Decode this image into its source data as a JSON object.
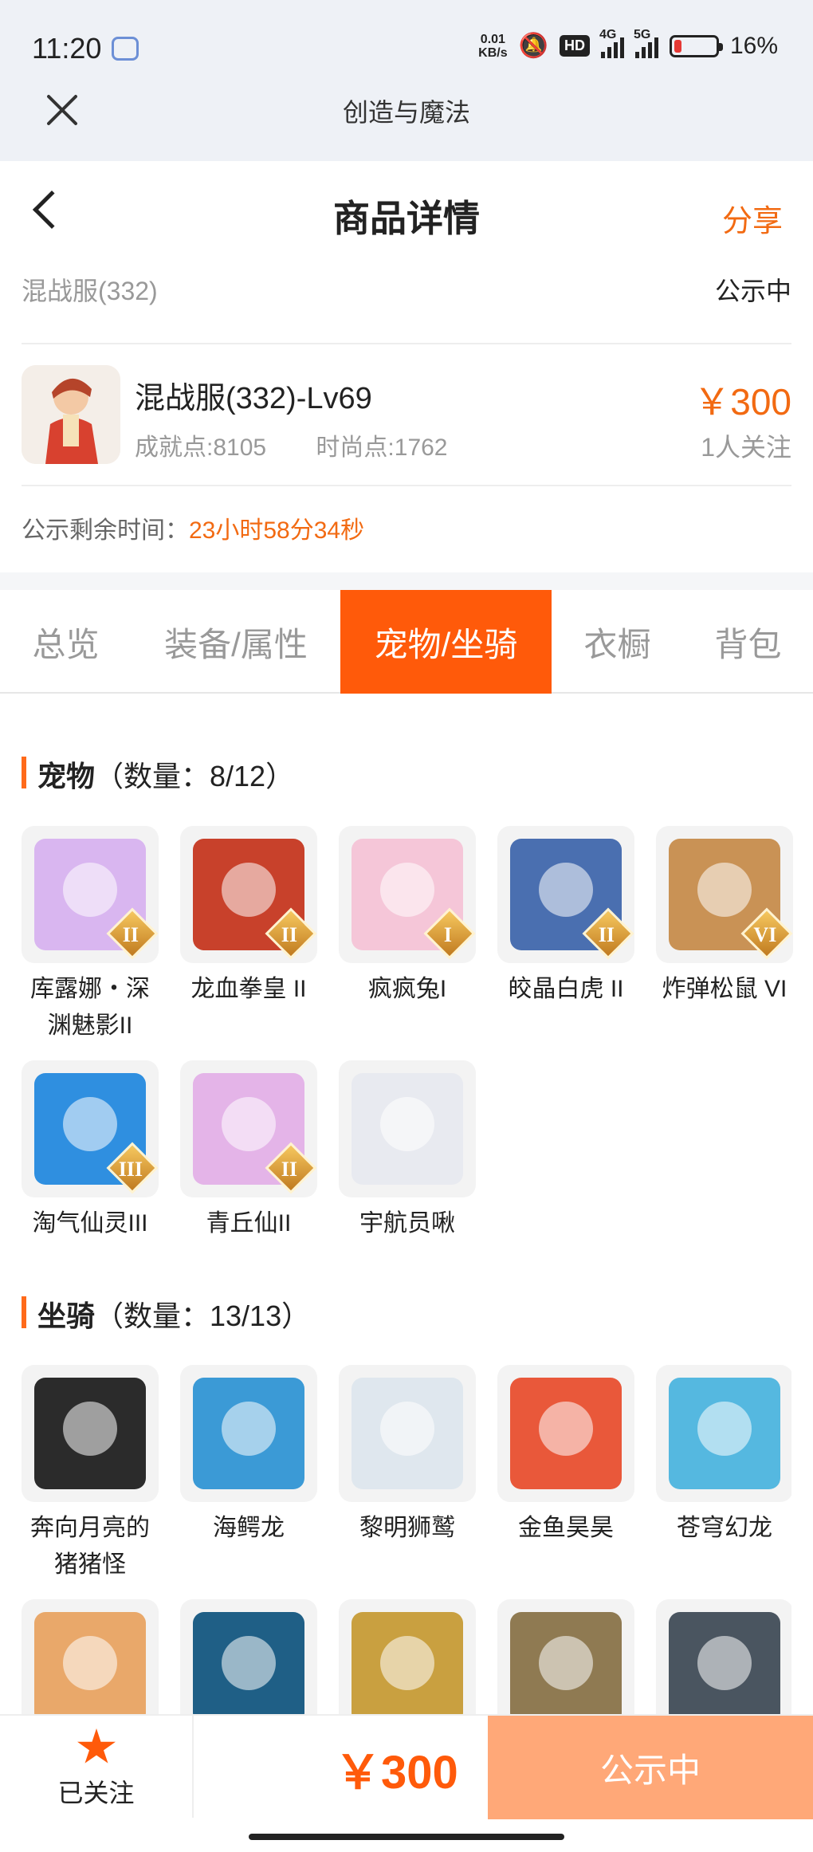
{
  "status_bar": {
    "time": "11:20",
    "net_speed_value": "0.01",
    "net_speed_unit": "KB/s",
    "hd_badge": "HD",
    "signal_4g": "4G",
    "signal_5g": "5G",
    "battery_percent": "16%",
    "battery_level": 0.16
  },
  "web_bar": {
    "title": "创造与魔法"
  },
  "header": {
    "title": "商品详情",
    "share_label": "分享"
  },
  "server": {
    "name": "混战服(332)",
    "status": "公示中"
  },
  "product": {
    "name": "混战服(332)-Lv69",
    "achievement": "成就点:8105",
    "fashion": "时尚点:1762",
    "price": "￥300",
    "followers": "1人关注"
  },
  "countdown": {
    "label": "公示剩余时间：",
    "value": "23小时58分34秒"
  },
  "tabs": [
    {
      "label": "总览",
      "active": false
    },
    {
      "label": "装备/属性",
      "active": false
    },
    {
      "label": "宠物/坐骑",
      "active": true
    },
    {
      "label": "衣橱",
      "active": false
    },
    {
      "label": "背包",
      "active": false
    }
  ],
  "pets": {
    "title": "宠物",
    "count": "（数量：8/12）",
    "items": [
      {
        "name": "库露娜・深渊魅影II",
        "rank": "II",
        "color": "#d9b6f0"
      },
      {
        "name": "龙血拳皇 II",
        "rank": "II",
        "color": "#c8412b"
      },
      {
        "name": "疯疯兔I",
        "rank": "I",
        "color": "#f5c6d8"
      },
      {
        "name": "皎晶白虎 II",
        "rank": "II",
        "color": "#4a6fb0"
      },
      {
        "name": "炸弹松鼠 VI",
        "rank": "VI",
        "color": "#c99255"
      },
      {
        "name": "淘气仙灵III",
        "rank": "III",
        "color": "#2f8fe0"
      },
      {
        "name": "青丘仙II",
        "rank": "II",
        "color": "#e4b4e8"
      },
      {
        "name": "宇航员啾",
        "rank": "",
        "color": "#e8eaf0"
      }
    ]
  },
  "mounts": {
    "title": "坐骑",
    "count": "（数量：13/13）",
    "items": [
      {
        "name": "奔向月亮的猪猪怪",
        "color": "#2b2b2b"
      },
      {
        "name": "海鳄龙",
        "color": "#3b9ad6"
      },
      {
        "name": "黎明狮鹫",
        "color": "#dfe7ee"
      },
      {
        "name": "金鱼昊昊",
        "color": "#e9583a"
      },
      {
        "name": "苍穹幻龙",
        "color": "#55b8e0"
      },
      {
        "name": "",
        "color": "#e9a86a"
      },
      {
        "name": "",
        "color": "#1f5f86"
      },
      {
        "name": "",
        "color": "#c9a040"
      },
      {
        "name": "",
        "color": "#8f7a52"
      },
      {
        "name": "",
        "color": "#4a5560"
      }
    ]
  },
  "bottom_bar": {
    "follow_label": "已关注",
    "price": "￥300",
    "action_label": "公示中"
  }
}
